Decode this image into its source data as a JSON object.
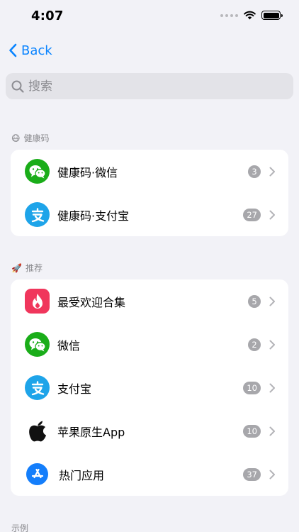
{
  "status_bar": {
    "time": "4:07"
  },
  "nav": {
    "back_label": "Back"
  },
  "search": {
    "placeholder": "搜索"
  },
  "sections": [
    {
      "header": "健康码",
      "emoji": "😷",
      "items": [
        {
          "title": "健康码·微信",
          "badge": "3",
          "icon": "wechat-icon"
        },
        {
          "title": "健康码·支付宝",
          "badge": "27",
          "icon": "alipay-icon"
        }
      ]
    },
    {
      "header": "推荐",
      "emoji": "🚀",
      "items": [
        {
          "title": "最受欢迎合集",
          "badge": "5",
          "icon": "flame-icon"
        },
        {
          "title": "微信",
          "badge": "2",
          "icon": "wechat-icon"
        },
        {
          "title": "支付宝",
          "badge": "10",
          "icon": "alipay-icon"
        },
        {
          "title": "苹果原生App",
          "badge": "10",
          "icon": "apple-icon"
        },
        {
          "title": "热门应用",
          "badge": "37",
          "icon": "app-store-icon"
        }
      ]
    },
    {
      "header": "示例"
    }
  ],
  "colors": {
    "accent": "#0A84FF",
    "wechat": "#1AAD19",
    "alipay": "#1EA4E9",
    "flame": "#F0365C",
    "app_store": "#147EFB",
    "badge": "#A7A7AB",
    "background": "#F2F2F7"
  }
}
